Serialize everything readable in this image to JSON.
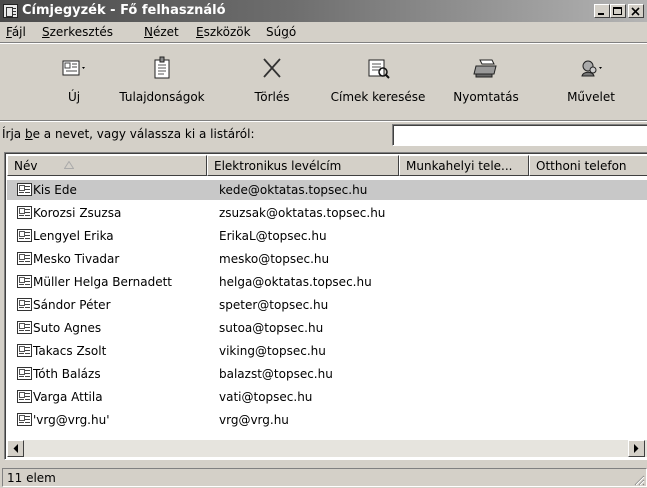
{
  "window": {
    "title": "Címjegyzék - Fő felhasználó"
  },
  "menu": [
    {
      "pre": "",
      "u": "F",
      "post": "ájl"
    },
    {
      "pre": "",
      "u": "S",
      "post": "zerkesztés"
    },
    {
      "pre": "",
      "u": "N",
      "post": "ézet"
    },
    {
      "pre": "",
      "u": "E",
      "post": "szközök"
    },
    {
      "pre": "Sú",
      "u": "g",
      "post": "ó"
    }
  ],
  "toolbar": {
    "new_label": "Új",
    "properties_label": "Tulajdonságok",
    "delete_label": "Törlés",
    "find_label": "Címek keresése",
    "print_label": "Nyomtatás",
    "action_label": "Művelet"
  },
  "search": {
    "label_pre": "Írja ",
    "label_u": "b",
    "label_post": "e a nevet, vagy válassza ki a listáról:",
    "value": ""
  },
  "columns": [
    "Név",
    "Elektronikus levélcím",
    "Munkahelyi tele...",
    "Otthoni telefon"
  ],
  "contacts": [
    {
      "name": "Kis Ede",
      "email": "kede@oktatas.topsec.hu"
    },
    {
      "name": "Korozsi Zsuzsa",
      "email": "zsuzsak@oktatas.topsec.hu"
    },
    {
      "name": "Lengyel Erika",
      "email": "ErikaL@topsec.hu"
    },
    {
      "name": "Mesko Tivadar",
      "email": "mesko@topsec.hu"
    },
    {
      "name": "Müller Helga Bernadett",
      "email": "helga@oktatas.topsec.hu"
    },
    {
      "name": "Sándor Péter",
      "email": "speter@topsec.hu"
    },
    {
      "name": "Suto Agnes",
      "email": "sutoa@topsec.hu"
    },
    {
      "name": "Takacs Zsolt",
      "email": "viking@topsec.hu"
    },
    {
      "name": "Tóth Balázs",
      "email": "balazst@topsec.hu"
    },
    {
      "name": "Varga Attila",
      "email": "vati@topsec.hu"
    },
    {
      "name": "'vrg@vrg.hu'",
      "email": "vrg@vrg.hu"
    }
  ],
  "selected_index": 0,
  "status": {
    "text": "11 elem"
  },
  "icons": {
    "app": "address-book-icon",
    "new": "new-contact-icon",
    "properties": "properties-icon",
    "delete": "delete-icon",
    "find": "find-people-icon",
    "print": "printer-icon",
    "action": "action-icon"
  }
}
